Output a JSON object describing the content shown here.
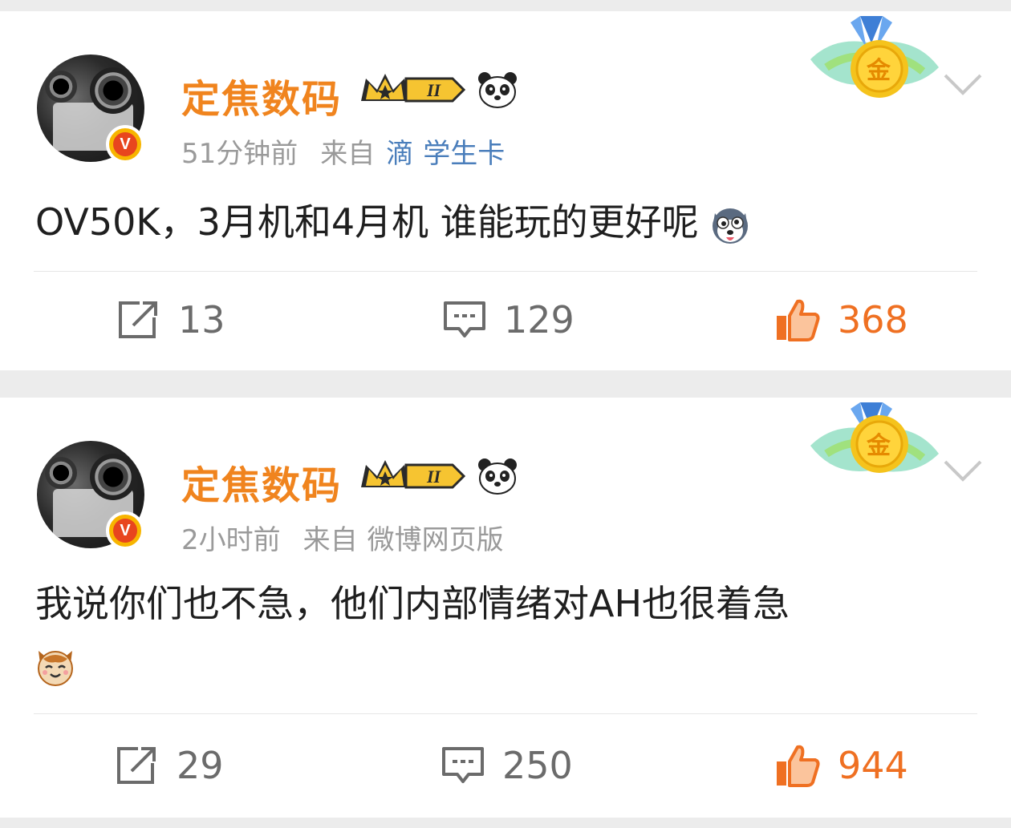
{
  "posts": [
    {
      "author": "定焦数码",
      "time": "51分钟前",
      "source_prefix": "来自",
      "source_link1": "滴",
      "source_link2": "学生卡",
      "content": "OV50K，3月机和4月机 谁能玩的更好呢",
      "shares": "13",
      "comments": "129",
      "likes": "368",
      "medal_text": "金",
      "verified_mark": "V",
      "level_badge": "II"
    },
    {
      "author": "定焦数码",
      "time": "2小时前",
      "source_prefix": "来自",
      "source": "微博网页版",
      "content": "我说你们也不急，他们内部情绪对AH也很着急",
      "shares": "29",
      "comments": "250",
      "likes": "944",
      "medal_text": "金",
      "verified_mark": "V",
      "level_badge": "II"
    }
  ],
  "colors": {
    "author": "#f0841e",
    "link": "#4a7ebb",
    "meta": "#9a9a9a",
    "like": "#ef7022",
    "text": "#1f1f1f"
  }
}
